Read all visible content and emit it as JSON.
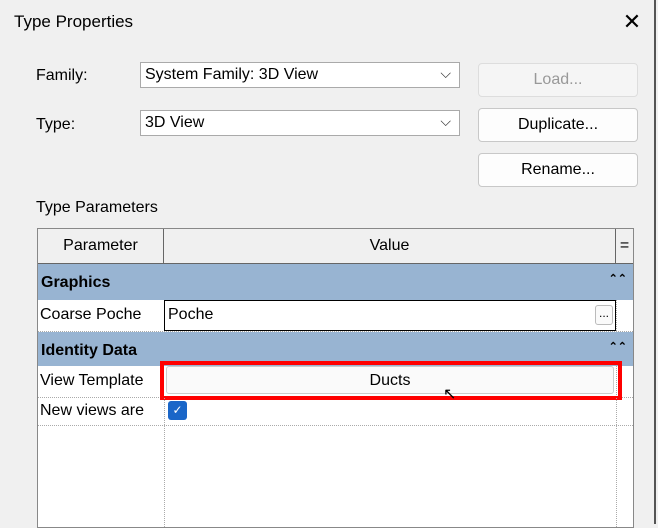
{
  "title": "Type Properties",
  "family": {
    "label": "Family:",
    "value": "System Family: 3D View"
  },
  "type": {
    "label": "Type:",
    "value": "3D View"
  },
  "buttons": {
    "load": "Load...",
    "duplicate": "Duplicate...",
    "rename": "Rename..."
  },
  "type_parameters_label": "Type Parameters",
  "table": {
    "headers": {
      "parameter": "Parameter",
      "value": "Value",
      "toggle": "="
    },
    "groups": [
      {
        "name": "Graphics",
        "rows": [
          {
            "parameter": "Coarse Poche",
            "value": "Poche",
            "button": "..."
          }
        ]
      },
      {
        "name": "Identity Data",
        "rows": [
          {
            "parameter": "View Template",
            "value": "Ducts"
          },
          {
            "parameter": "New views are",
            "checked": true
          }
        ]
      }
    ]
  },
  "colors": {
    "group_header": "#98b4d2",
    "highlight": "#ff0000",
    "checkbox": "#1a66c8"
  }
}
